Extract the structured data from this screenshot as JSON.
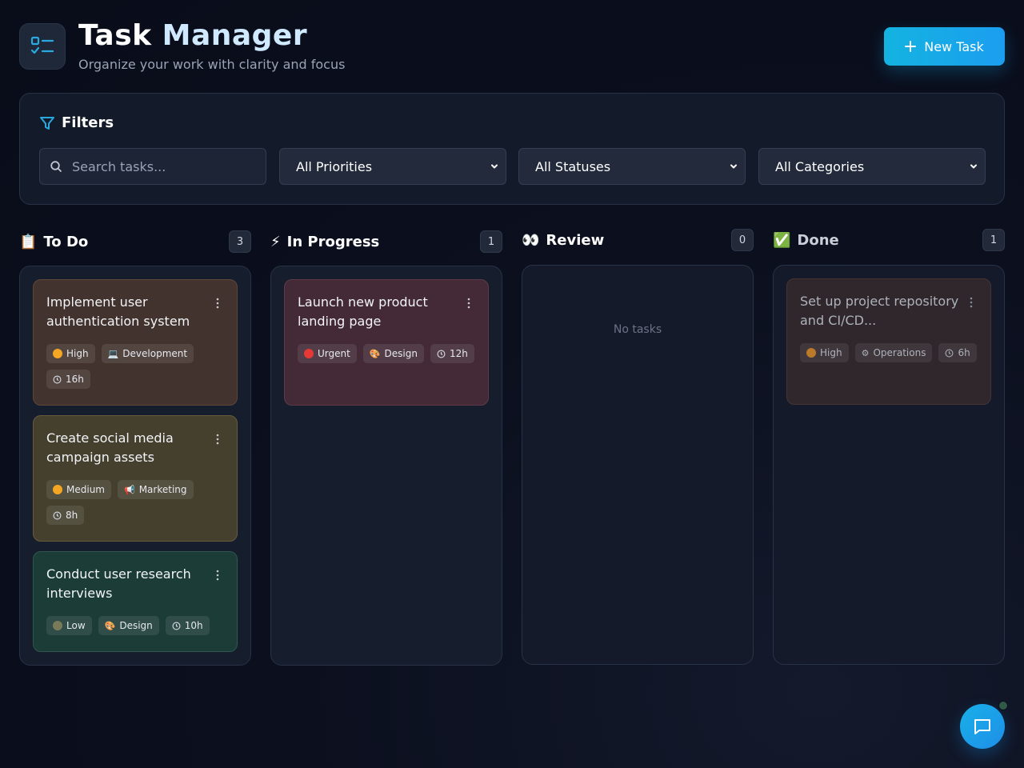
{
  "header": {
    "title_main": "Task ",
    "title_accent": "Manager",
    "subtitle": "Organize your work with clarity and focus",
    "new_task_label": "New Task"
  },
  "filters": {
    "title": "Filters",
    "search_placeholder": "Search tasks...",
    "priority_selected": "All Priorities",
    "status_selected": "All Statuses",
    "category_selected": "All Categories"
  },
  "columns": [
    {
      "emoji": "📋",
      "label": "To Do",
      "count": "3",
      "cards": [
        {
          "title": "Implement user authentication system",
          "priority": "High",
          "priority_color": "#f5a623",
          "category_emoji": "💻",
          "category": "Development",
          "hours": "16h"
        },
        {
          "title": "Create social media campaign assets",
          "priority": "Medium",
          "priority_color": "#f5a623",
          "category_emoji": "📢",
          "category": "Marketing",
          "hours": "8h"
        },
        {
          "title": "Conduct user research interviews",
          "priority": "Low",
          "priority_color": "#7a7a5a",
          "category_emoji": "🎨",
          "category": "Design",
          "hours": "10h"
        }
      ]
    },
    {
      "emoji": "⚡",
      "label": "In Progress",
      "count": "1",
      "cards": [
        {
          "title": "Launch new product landing page",
          "priority": "Urgent",
          "priority_color": "#e53935",
          "category_emoji": "🎨",
          "category": "Design",
          "hours": "12h"
        }
      ]
    },
    {
      "emoji": "👀",
      "label": "Review",
      "count": "0",
      "empty_text": "No tasks"
    },
    {
      "emoji": "✅",
      "label": "Done",
      "count": "1",
      "cards": [
        {
          "title": "Set up project repository and CI/CD...",
          "priority": "High",
          "priority_color": "#d98a2b",
          "category_emoji": "⚙",
          "category": "Operations",
          "hours": "6h"
        }
      ]
    }
  ],
  "colors": {
    "accent": "#1b9ef0",
    "background": "#0b0f1e",
    "panel": "#131a2a"
  }
}
